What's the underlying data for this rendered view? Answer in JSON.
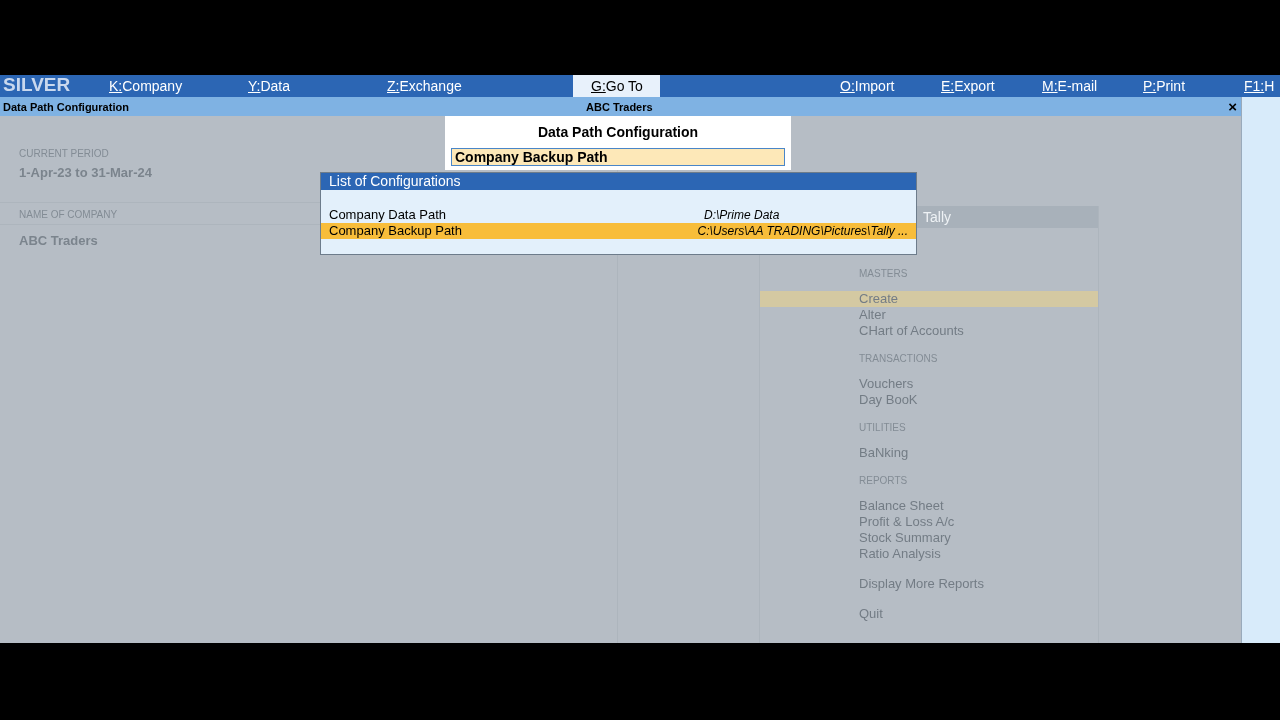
{
  "brand": "SILVER",
  "menu": [
    {
      "key": "K:",
      "label": "Company",
      "selected": false
    },
    {
      "key": "Y:",
      "label": "Data",
      "selected": false
    },
    {
      "key": "Z:",
      "label": "Exchange",
      "selected": false
    },
    {
      "key": "G:",
      "label": "Go To",
      "selected": true
    },
    {
      "key": "O:",
      "label": "Import",
      "selected": false
    },
    {
      "key": "E:",
      "label": "Export",
      "selected": false
    },
    {
      "key": "M:",
      "label": "E-mail",
      "selected": false
    },
    {
      "key": "P:",
      "label": "Print",
      "selected": false
    },
    {
      "key": "F1:",
      "label": "H",
      "selected": false
    }
  ],
  "title_bar": {
    "screen": "Data Path Configuration",
    "company": "ABC Traders",
    "close": "×"
  },
  "background": {
    "period_label": "CURRENT PERIOD",
    "period": "1-Apr-23 to 31-Mar-24",
    "company_label": "NAME OF COMPANY",
    "company": "ABC Traders",
    "gateway": {
      "title": "Tally",
      "sections": [
        {
          "heading": "MASTERS",
          "items": [
            {
              "label": "Create",
              "selected": true
            },
            {
              "label": "Alter",
              "selected": false
            },
            {
              "label": "CHart of Accounts",
              "selected": false
            }
          ]
        },
        {
          "heading": "TRANSACTIONS",
          "items": [
            {
              "label": "Vouchers",
              "selected": false
            },
            {
              "label": "Day BooK",
              "selected": false
            }
          ]
        },
        {
          "heading": "UTILITIES",
          "items": [
            {
              "label": "BaNking",
              "selected": false
            }
          ]
        },
        {
          "heading": "REPORTS",
          "items": [
            {
              "label": "Balance Sheet",
              "selected": false
            },
            {
              "label": "Profit & Loss A/c",
              "selected": false
            },
            {
              "label": "Stock Summary",
              "selected": false
            },
            {
              "label": "Ratio Analysis",
              "selected": false
            }
          ]
        },
        {
          "items": [
            {
              "label": "Display More Reports",
              "selected": false
            }
          ]
        },
        {
          "items": [
            {
              "label": "Quit",
              "selected": false
            }
          ]
        }
      ]
    }
  },
  "dialog": {
    "title": "Data Path Configuration",
    "value": "Company Backup Path"
  },
  "list": {
    "title": "List of Configurations",
    "rows": [
      {
        "name": "Company Data Path",
        "path": "D:\\Prime Data",
        "selected": false
      },
      {
        "name": "Company Backup Path",
        "path": "C:\\Users\\AA TRADING\\Pictures\\Tally ...",
        "selected": true
      }
    ]
  }
}
